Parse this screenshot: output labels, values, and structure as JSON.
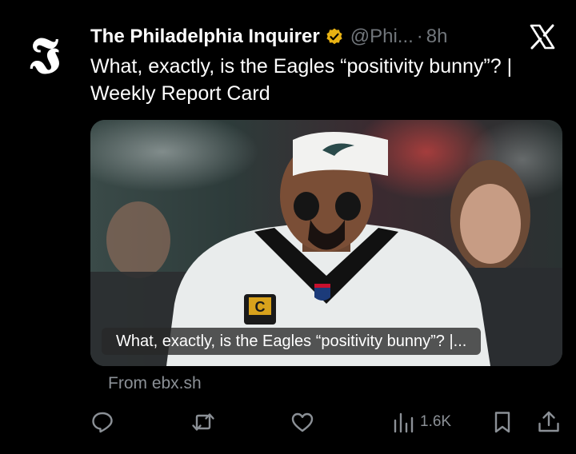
{
  "post": {
    "author_name": "The Philadelphia Inquirer",
    "handle": "@Phi...",
    "separator": "·",
    "time": "8h",
    "text": "What, exactly, is the Eagles “positivity bunny”? | Weekly Report Card",
    "avatar_glyph": "𝕴",
    "icons": {
      "verified": "verified-badge-gold",
      "platform": "x-logo"
    }
  },
  "card": {
    "caption": "What, exactly, is the Eagles “positivity bunny”? |...",
    "source": "From ebx.sh"
  },
  "actions": {
    "reply_icon": "reply-icon",
    "repost_icon": "repost-icon",
    "like_icon": "heart-icon",
    "views_icon": "views-icon",
    "views_count": "1.6K",
    "bookmark_icon": "bookmark-icon",
    "share_icon": "share-icon"
  },
  "colors": {
    "background": "#000000",
    "text_primary": "#ffffff",
    "text_secondary": "#71767b",
    "verified_gold": "#e8b213"
  }
}
